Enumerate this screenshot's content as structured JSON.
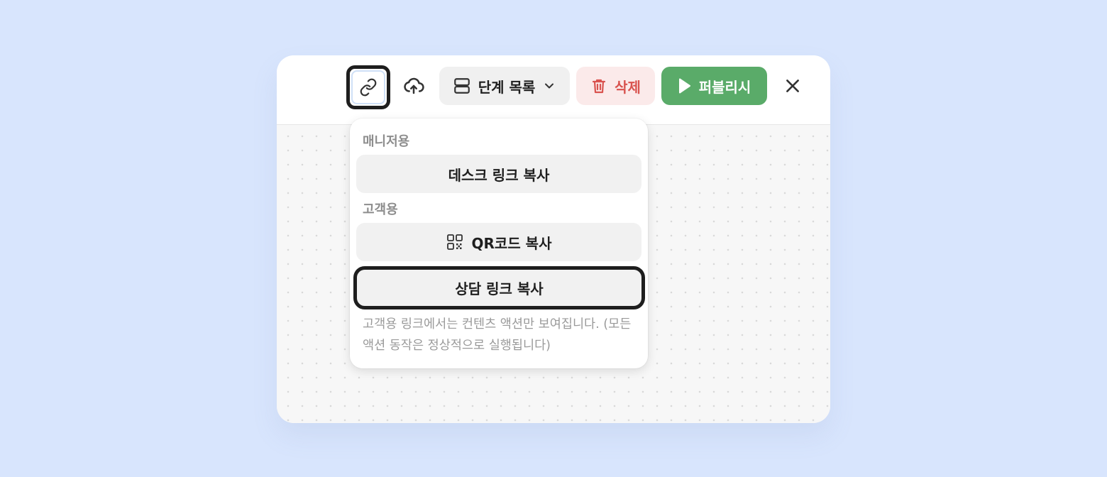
{
  "toolbar": {
    "steps_label": "단계 목록",
    "delete_label": "삭제",
    "publish_label": "퍼블리시"
  },
  "link_menu": {
    "manager_section_label": "매니저용",
    "desk_link_label": "데스크 링크 복사",
    "customer_section_label": "고객용",
    "qr_code_label": "QR코드 복사",
    "consult_link_label": "상담 링크 복사",
    "note": "고객용 링크에서는 컨텐츠 액션만 보여집니다. (모든 액션 동작은 정상적으로 실행됩니다)"
  },
  "icons": {
    "link": "link-icon",
    "upload": "cloud-upload-icon",
    "steps": "list-layout-icon",
    "chevron": "chevron-down-icon",
    "trash": "trash-icon",
    "play": "play-icon",
    "close": "close-icon",
    "qr": "qr-code-icon"
  },
  "colors": {
    "background": "#d8e5fd",
    "delete_text": "#d9534f",
    "delete_bg": "#fbeaea",
    "publish_bg": "#5aab69",
    "focus_outline": "#1e1e1e"
  }
}
